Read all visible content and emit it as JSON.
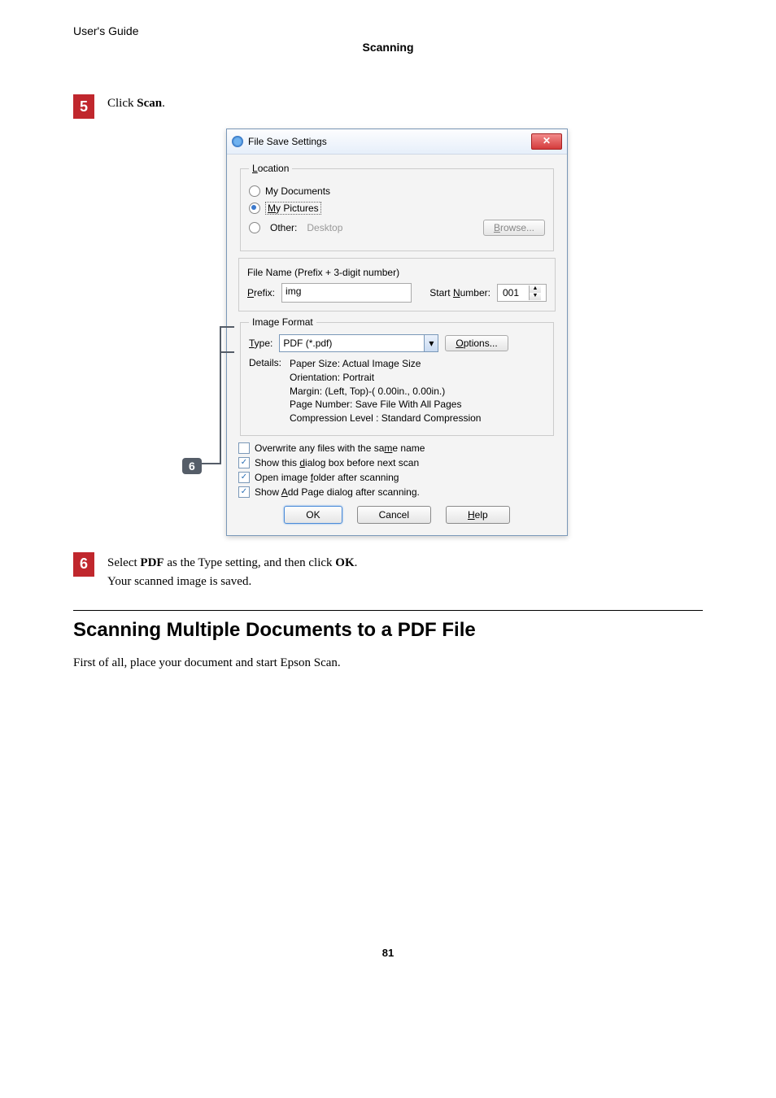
{
  "doc_header": "User's Guide",
  "section_center": "Scanning",
  "step5": {
    "num": "5",
    "prefix": "Click ",
    "bold": "Scan",
    "suffix": "."
  },
  "callout6": "6",
  "dialog": {
    "title": "File Save Settings",
    "close": "✕",
    "location": {
      "legend_key": "L",
      "legend_rest": "ocation",
      "my_documents": "My Documents",
      "my_pictures_key": "M",
      "my_pictures_rest": "y Pictures",
      "other": "Other:",
      "desktop": "Desktop",
      "browse_key": "B",
      "browse_rest": "rowse..."
    },
    "filename": {
      "header": "File Name (Prefix + 3-digit number)",
      "prefix_key": "P",
      "prefix_rest": "refix:",
      "prefix_value": "img",
      "startnum_pre": "Start ",
      "startnum_key": "N",
      "startnum_post": "umber:",
      "startnum_value": "001"
    },
    "imageformat": {
      "legend_pre": "Ima",
      "legend_key": "g",
      "legend_post": "e Format",
      "type_key": "T",
      "type_rest": "ype:",
      "type_value": "PDF (*.pdf)",
      "options_key": "O",
      "options_rest": "ptions...",
      "details_label": "Details:",
      "details_l1": "Paper Size: Actual Image Size",
      "details_l2": "Orientation: Portrait",
      "details_l3": "Margin: (Left, Top)-( 0.00in., 0.00in.)",
      "details_l4": "Page Number: Save File With All Pages",
      "details_l5": "Compression Level : Standard Compression"
    },
    "checks": {
      "overwrite_pre": "Overwrite any files with the sa",
      "overwrite_key": "m",
      "overwrite_post": "e name",
      "showdlg_pre": "Show this ",
      "showdlg_key": "d",
      "showdlg_post": "ialog box before next scan",
      "openfolder_pre": "Open image ",
      "openfolder_key": "f",
      "openfolder_post": "older after scanning",
      "showadd_pre": "Show ",
      "showadd_key": "A",
      "showadd_post": "dd Page dialog after scanning."
    },
    "buttons": {
      "ok": "OK",
      "cancel": "Cancel",
      "help_key": "H",
      "help_rest": "elp"
    }
  },
  "step6": {
    "num": "6",
    "t1": "Select ",
    "b1": "PDF",
    "t2": " as the Type setting, and then click ",
    "b2": "OK",
    "t3": ".",
    "note": "Your scanned image is saved."
  },
  "section2_heading": "Scanning Multiple Documents to a PDF File",
  "section2_body": "First of all, place your document and start Epson Scan.",
  "pagenum": "81"
}
